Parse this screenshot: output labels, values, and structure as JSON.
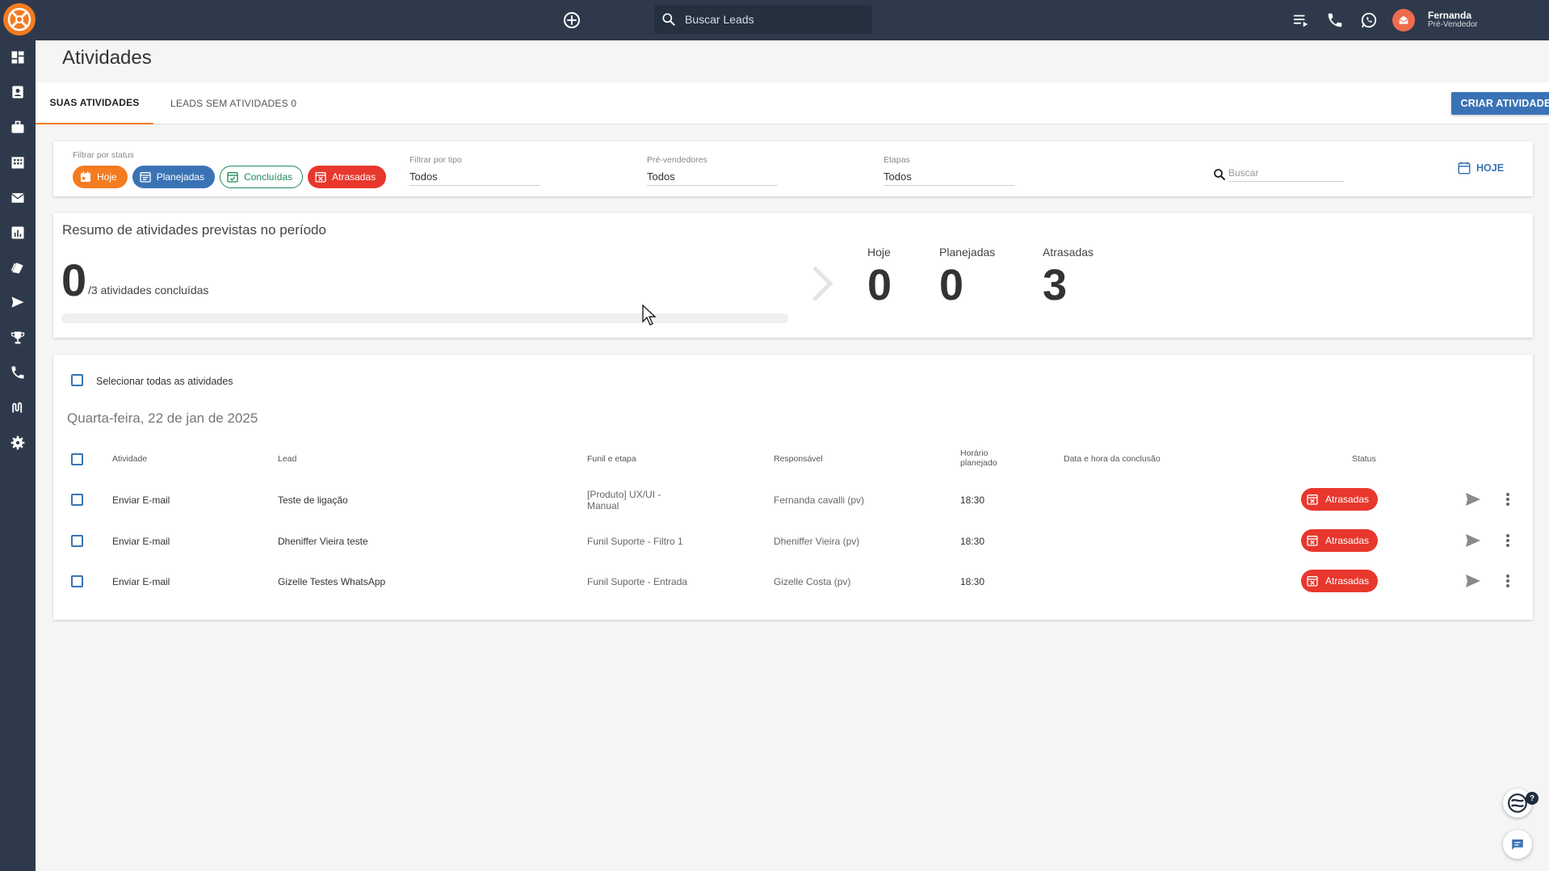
{
  "header": {
    "search_placeholder": "Buscar Leads",
    "user_name": "Fernanda",
    "user_role": "Pré-Vendedor"
  },
  "page": {
    "title": "Atividades"
  },
  "tabs": [
    {
      "label": "SUAS ATIVIDADES",
      "active": true
    },
    {
      "label": "LEADS SEM ATIVIDADES 0",
      "active": false
    }
  ],
  "create_button": "CRIAR ATIVIDADE",
  "filters": {
    "status_label": "Filtrar por status",
    "chips": [
      "Hoje",
      "Planejadas",
      "Concluídas",
      "Atrasadas"
    ],
    "type_label": "Filtrar por tipo",
    "type_value": "Todos",
    "presales_label": "Pré-vendedores",
    "presales_value": "Todos",
    "stages_label": "Etapas",
    "stages_value": "Todos",
    "search_placeholder": "Buscar",
    "today_link": "HOJE"
  },
  "summary": {
    "title": "Resumo de atividades previstas no período",
    "done": "0",
    "done_label": "/3 atividades concluídas",
    "progress_fraction": 0,
    "stats": [
      {
        "label": "Hoje",
        "value": "0"
      },
      {
        "label": "Planejadas",
        "value": "0"
      },
      {
        "label": "Atrasadas",
        "value": "3"
      }
    ]
  },
  "activities": {
    "select_all_label": "Selecionar todas as atividades",
    "date_heading": "Quarta-feira, 22 de jan de 2025",
    "columns": [
      "Atividade",
      "Lead",
      "Funil e etapa",
      "Responsável",
      "Horário planejado",
      "Data e hora da conclusão",
      "Status"
    ],
    "rows": [
      {
        "activity": "Enviar E-mail",
        "lead": "Teste de ligação",
        "funnel": "[Produto] UX/UI - Manual",
        "owner": "Fernanda cavalli (pv)",
        "time": "18:30",
        "completed": "",
        "status": "Atrasadas"
      },
      {
        "activity": "Enviar E-mail",
        "lead": "Dheniffer Vieira teste",
        "funnel": "Funil Suporte - Filtro 1",
        "owner": "Dheniffer Vieira (pv)",
        "time": "18:30",
        "completed": "",
        "status": "Atrasadas"
      },
      {
        "activity": "Enviar E-mail",
        "lead": "Gizelle Testes WhatsApp",
        "funnel": "Funil Suporte - Entrada",
        "owner": "Gizelle Costa (pv)",
        "time": "18:30",
        "completed": "",
        "status": "Atrasadas"
      }
    ]
  },
  "colors": {
    "brand": "#f47b20",
    "primary": "#3a73b5",
    "danger": "#e8372c",
    "success": "#1f8a5b",
    "nav": "#2e3a4b"
  }
}
